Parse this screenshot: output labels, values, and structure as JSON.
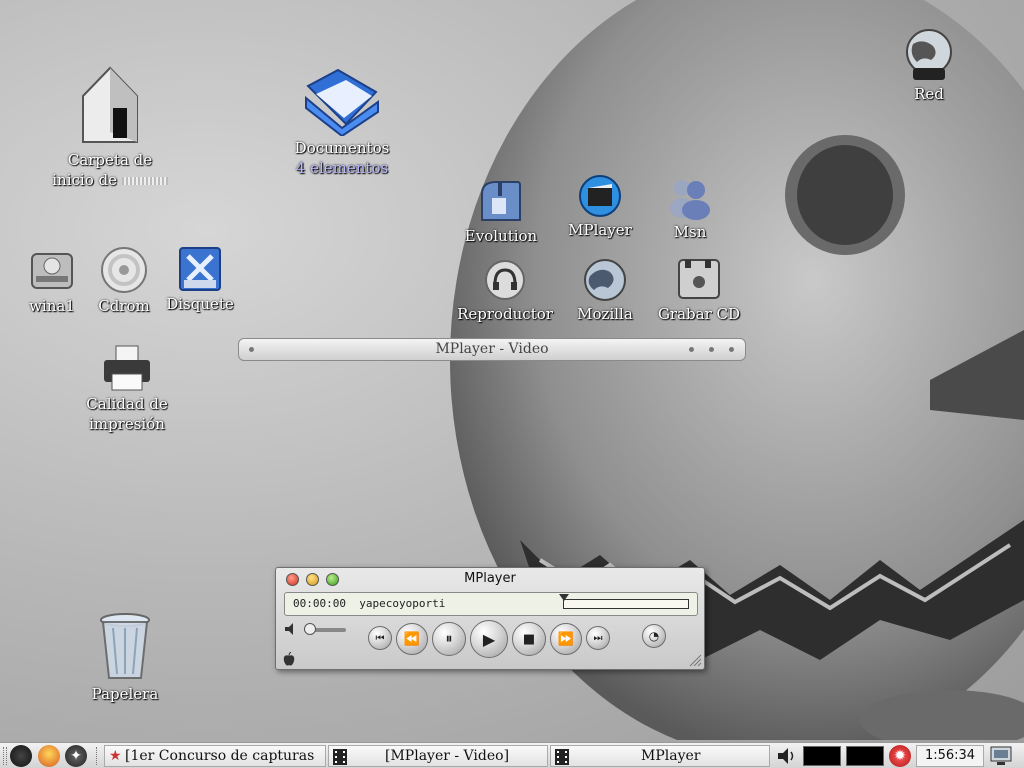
{
  "desktop": {
    "icons": {
      "home": {
        "line1": "Carpeta de",
        "line2": "inicio de"
      },
      "documentos": {
        "name": "Documentos",
        "count": "4 elementos"
      },
      "red": {
        "label": "Red"
      },
      "wina1": {
        "label": "wina1"
      },
      "cdrom": {
        "label": "Cdrom"
      },
      "disquete": {
        "label": "Disquete"
      },
      "impresion": {
        "line1": "Calidad de",
        "line2": "impresión"
      },
      "evolution": {
        "label": "Evolution"
      },
      "mplayer": {
        "label": "MPlayer"
      },
      "msn": {
        "label": "Msn"
      },
      "reproductor": {
        "label": "Reproductor"
      },
      "mozilla": {
        "label": "Mozilla"
      },
      "grabar_cd": {
        "label": "Grabar CD"
      },
      "papelera": {
        "label": "Papelera"
      }
    }
  },
  "video_window": {
    "title": "MPlayer - Video"
  },
  "mplayer": {
    "title": "MPlayer",
    "time": "00:00:00",
    "track": "yapecoyoporti",
    "progress": 0.0,
    "volume": 0.1
  },
  "taskbar": {
    "tasks": [
      {
        "label": "[1er Concurso de capturas"
      },
      {
        "label": "[MPlayer - Video]"
      },
      {
        "label": "MPlayer"
      }
    ],
    "clock": "1:56:34"
  },
  "colors": {
    "accent_blue": "#2f6fd6",
    "desktop_gray": "#b8b8b8"
  }
}
